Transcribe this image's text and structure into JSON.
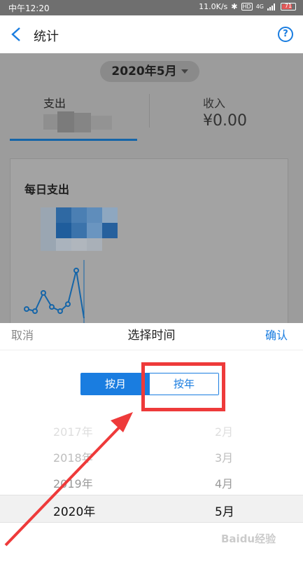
{
  "status_bar": {
    "time": "中午12:20",
    "speed": "11.0K/s",
    "network": "4G",
    "battery_level": "71"
  },
  "header": {
    "title": "统计"
  },
  "background": {
    "month": "2020年5月",
    "tab_expense": "支出",
    "tab_income": "收入",
    "income_value": "¥0.00",
    "card_title": "每日支出"
  },
  "sheet": {
    "cancel": "取消",
    "title": "选择时间",
    "confirm": "确认",
    "segment_month": "按月",
    "segment_year": "按年",
    "rows": [
      {
        "year": "2017年",
        "month": "2月"
      },
      {
        "year": "2018年",
        "month": "3月"
      },
      {
        "year": "2019年",
        "month": "4月"
      },
      {
        "year": "2020年",
        "month": "5月"
      }
    ]
  },
  "colors": {
    "accent": "#1a7de0",
    "highlight": "#ee3a3a"
  },
  "watermark": "Baidu经验"
}
